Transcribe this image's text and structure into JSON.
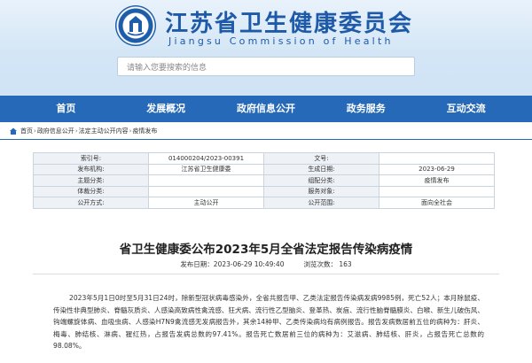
{
  "site": {
    "title": "江苏省卫生健康委员会",
    "subtitle": "Jiangsu Commission of Health",
    "search_placeholder": "请输入您要搜索的信息",
    "brand_color": "#2569b8"
  },
  "nav": {
    "items": [
      "首页",
      "发展概况",
      "政府信息公开",
      "政务服务",
      "互动交流"
    ]
  },
  "breadcrumb": [
    "首页",
    "政府信息公开",
    "法定主动公开内容",
    "疫情发布"
  ],
  "meta": {
    "rows": [
      [
        {
          "label": "索引号:",
          "value": "014000204/2023-00391"
        },
        {
          "label": "文号:",
          "value": ""
        }
      ],
      [
        {
          "label": "发布机构:",
          "value": "江苏省卫生健康委"
        },
        {
          "label": "生成日期:",
          "value": "2023-06-29"
        }
      ],
      [
        {
          "label": "主题分类:",
          "value": ""
        },
        {
          "label": "组配分类:",
          "value": "疫情发布"
        }
      ],
      [
        {
          "label": "体裁分类:",
          "value": ""
        },
        {
          "label": "服务对象:",
          "value": ""
        }
      ],
      [
        {
          "label": "公开方式:",
          "value": "主动公开"
        },
        {
          "label": "公开范围:",
          "value": "面向全社会"
        }
      ]
    ]
  },
  "article": {
    "title": "省卫生健康委公布2023年5月全省法定报告传染病疫情",
    "publish_time": "发布日期：2023-06-29 10:49:40",
    "views": "浏览次数： 163",
    "body": "2023年5月1日0时至5月31日24时，除新型冠状病毒感染外，全省共报告甲、乙类法定报告传染病发病9985例，死亡52人；本月除鼠疫、传染性非典型肺炎、脊髓灰质炎、人感染高致病性禽流感、狂犬病、流行性乙型脑炎、登革热、炭疽、流行性脑脊髓膜炎、白喉、新生儿破伤风、钩端螺旋体病、血吸虫病、人感染H7N9禽流感无发病报告外，其余14种甲、乙类传染病均有病例报告。报告发病数居前五位的病种为：肝炎、梅毒、肺结核、淋病、猩红热，占报告发病总数的97.41%。报告死亡数居前三位的病种为：艾滋病、肺结核、肝炎，占报告死亡总数的98.08%。"
  }
}
